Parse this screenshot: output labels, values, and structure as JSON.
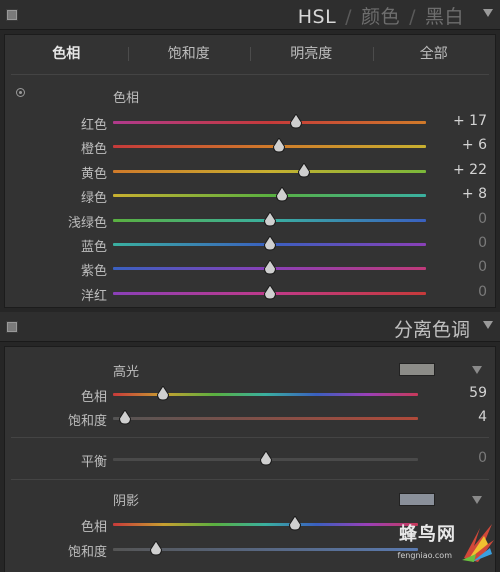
{
  "hsl_panel": {
    "tabs": [
      "HSL",
      "颜色",
      "黑白"
    ],
    "separator": "/",
    "subtabs": [
      "色相",
      "饱和度",
      "明亮度",
      "全部"
    ],
    "group_label": "色相",
    "rows": [
      {
        "label": "红色",
        "value": "+ 17",
        "num": 17,
        "gradient": [
          "#b03a8c",
          "#c63a3a",
          "#d07a2a"
        ]
      },
      {
        "label": "橙色",
        "value": "+ 6",
        "num": 6,
        "gradient": [
          "#c63a3a",
          "#d07a2a",
          "#c8b030"
        ]
      },
      {
        "label": "黄色",
        "value": "+ 22",
        "num": 22,
        "gradient": [
          "#d07a2a",
          "#c8b030",
          "#7ab83a"
        ]
      },
      {
        "label": "绿色",
        "value": "+ 8",
        "num": 8,
        "gradient": [
          "#c8b030",
          "#5ab040",
          "#3ab0a0"
        ]
      },
      {
        "label": "浅绿色",
        "value": "0",
        "num": 0,
        "gradient": [
          "#5ab040",
          "#3ab0a0",
          "#3a60c0"
        ]
      },
      {
        "label": "蓝色",
        "value": "0",
        "num": 0,
        "gradient": [
          "#3ab0a0",
          "#3a60c0",
          "#8a40b8"
        ]
      },
      {
        "label": "紫色",
        "value": "0",
        "num": 0,
        "gradient": [
          "#3a60c0",
          "#8a40b8",
          "#c03a7a"
        ]
      },
      {
        "label": "洋红",
        "value": "0",
        "num": 0,
        "gradient": [
          "#8a40b8",
          "#c03a8a",
          "#c63a3a"
        ]
      }
    ]
  },
  "split_panel": {
    "title": "分离色调",
    "highlights": {
      "label": "高光",
      "swatch_color": "#8c8c88",
      "hue": {
        "label": "色相",
        "value": "59",
        "num": 59
      },
      "saturation": {
        "label": "饱和度",
        "value": "4",
        "num": 4
      }
    },
    "balance": {
      "label": "平衡",
      "value": "0",
      "num": 0
    },
    "shadows": {
      "label": "阴影",
      "swatch_color": "#8a909a",
      "hue": {
        "label": "色相",
        "num": 215
      },
      "saturation": {
        "label": "饱和度",
        "num": 14
      }
    }
  },
  "watermark": {
    "brand": "蜂鸟网",
    "url": "fengniao.com"
  }
}
